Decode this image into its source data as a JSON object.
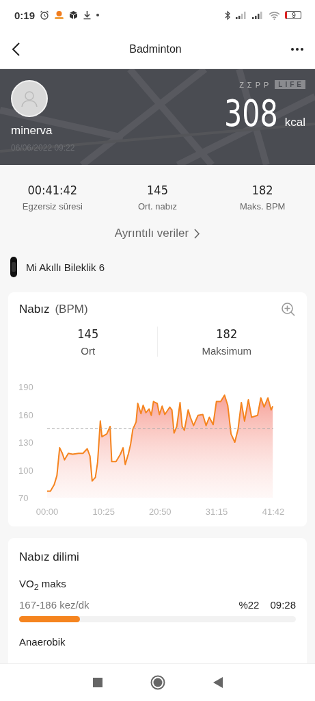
{
  "status_bar": {
    "time": "0:19",
    "battery": "9"
  },
  "header": {
    "title": "Badminton"
  },
  "banner": {
    "brand": "ZΣPP",
    "brand_box": "LIFE",
    "user": "minerva",
    "date": "06/06/2022 09:22",
    "calories": "308",
    "unit": "kcal"
  },
  "stats": [
    {
      "value": "00:41:42",
      "label": "Egzersiz süresi"
    },
    {
      "value": "145",
      "label": "Ort. nabız"
    },
    {
      "value": "182",
      "label": "Maks. BPM"
    }
  ],
  "details_link": "Ayrıntılı veriler",
  "device": "Mi Akıllı Bileklik 6",
  "heart_card": {
    "title": "Nabız",
    "unit": "(BPM)",
    "summary": [
      {
        "value": "145",
        "label": "Ort"
      },
      {
        "value": "182",
        "label": "Maksimum"
      }
    ],
    "chart_data": {
      "type": "area",
      "xlim": [
        0,
        41.7
      ],
      "ylim": [
        70,
        190
      ],
      "yticks": [
        70,
        100,
        130,
        160,
        190
      ],
      "xticks": [
        {
          "value": 0,
          "label": "00:00"
        },
        {
          "value": 10.42,
          "label": "10:25"
        },
        {
          "value": 20.83,
          "label": "20:50"
        },
        {
          "value": 31.25,
          "label": "31:15"
        },
        {
          "value": 41.7,
          "label": "41:42"
        }
      ],
      "ref_lines": [
        {
          "axis": "y",
          "value": 145
        }
      ],
      "x": [
        0,
        0.6,
        1.3,
        1.8,
        2.3,
        2.8,
        3.2,
        3.9,
        4.7,
        5.8,
        6.6,
        7.4,
        7.9,
        8.3,
        8.9,
        9.3,
        9.8,
        10.1,
        11.0,
        11.6,
        11.9,
        12.7,
        13.5,
        14.0,
        14.4,
        15.0,
        15.4,
        15.8,
        16.4,
        16.7,
        17.3,
        17.7,
        18.2,
        18.8,
        19.2,
        19.6,
        20.3,
        20.7,
        21.2,
        21.7,
        22.6,
        23.0,
        23.4,
        23.9,
        24.5,
        24.9,
        25.3,
        26.0,
        26.4,
        27.0,
        27.8,
        28.7,
        29.3,
        29.9,
        30.6,
        31.2,
        32.0,
        32.7,
        33.3,
        33.9,
        34.6,
        35.2,
        35.8,
        36.4,
        37.1,
        37.7,
        38.8,
        39.4,
        40.0,
        40.7,
        41.3,
        41.6
      ],
      "series": [
        {
          "color": "#f5841f",
          "values": [
            77,
            77,
            84,
            94,
            124,
            118,
            111,
            118,
            117,
            118,
            118,
            123,
            115,
            88,
            92,
            108,
            153,
            136,
            139,
            147,
            109,
            109,
            117,
            124,
            106,
            118,
            128,
            144,
            152,
            172,
            161,
            170,
            162,
            166,
            159,
            174,
            172,
            160,
            169,
            160,
            168,
            165,
            140,
            147,
            173,
            147,
            143,
            165,
            157,
            148,
            159,
            160,
            148,
            157,
            149,
            174,
            174,
            181,
            170,
            139,
            130,
            144,
            173,
            153,
            176,
            157,
            159,
            178,
            168,
            178,
            165,
            169
          ]
        }
      ]
    }
  },
  "zone_card": {
    "title": "Nabız dilimi",
    "zones": [
      {
        "name": "VO$_{2}$ maks",
        "range": "167-186 kez/dk",
        "percent": "%22",
        "time": "09:28",
        "level": 0.22
      }
    ],
    "next_zone": "Anaerobik"
  }
}
